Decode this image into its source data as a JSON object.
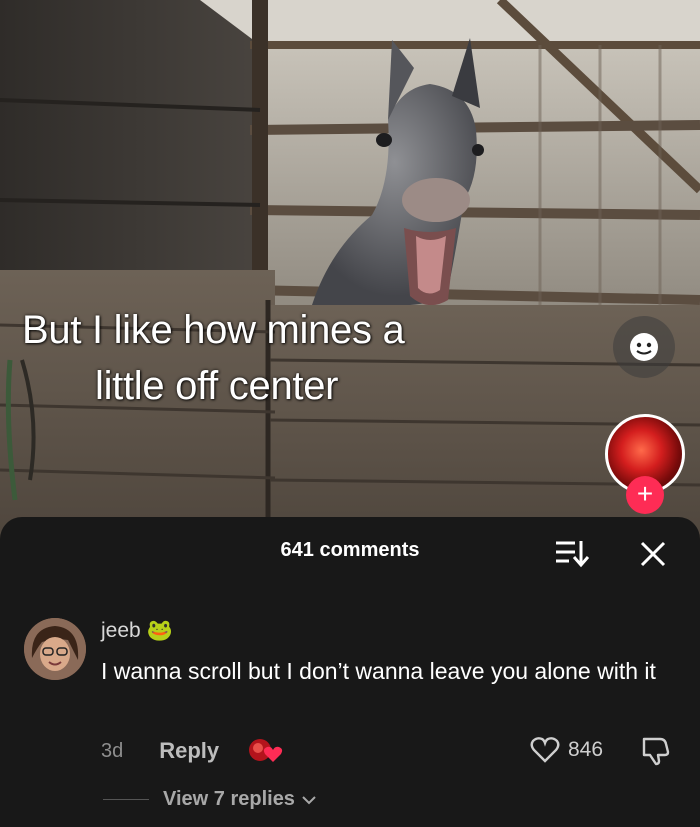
{
  "video": {
    "caption_line1": "But I like how mines a",
    "caption_line2": "little off center"
  },
  "comments_panel": {
    "count_label": "641 comments",
    "comment": {
      "username": "jeeb",
      "username_emoji": "🐸",
      "text": "I wanna scroll but I don’t wanna leave you alone with it",
      "time": "3d",
      "reply_label": "Reply",
      "like_count": "846",
      "view_replies_label": "View 7 replies"
    }
  },
  "colors": {
    "panel_bg": "#181818",
    "follow_accent": "#fe2c55"
  }
}
